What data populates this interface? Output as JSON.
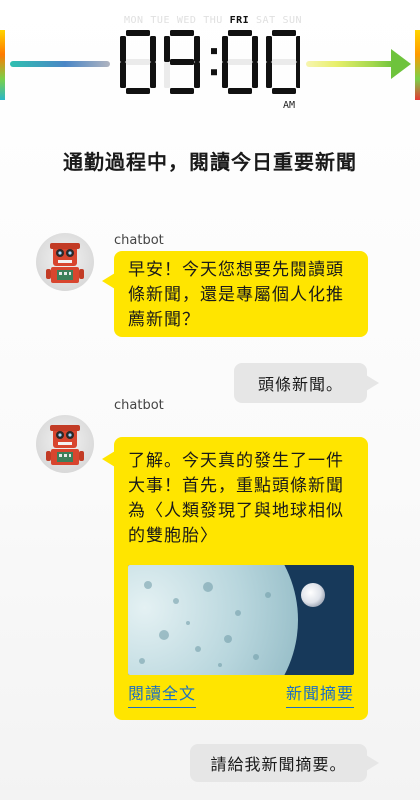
{
  "clock": {
    "days": [
      "MON",
      "TUE",
      "WED",
      "THU",
      "FRI",
      "SAT",
      "SUN"
    ],
    "active_day": "FRI",
    "time": "09:00",
    "ampm": "AM"
  },
  "headline": "通勤過程中，閱讀今日重要新聞",
  "chat": [
    {
      "sender": "chatbot",
      "text": "早安！今天您想要先閱讀頭條新聞，還是專屬個人化推薦新聞？"
    },
    {
      "from": "user",
      "text": "頭條新聞。"
    },
    {
      "sender": "chatbot",
      "text": "了解。今天真的發生了一件大事！首先，重點頭條新聞為〈人類發現了與地球相似的雙胞胎〉",
      "image": "planet-illustration",
      "links": {
        "read_full": "閱讀全文",
        "summary": "新聞摘要"
      }
    },
    {
      "from": "user",
      "text": "請給我新聞摘要。"
    }
  ],
  "colors": {
    "bot_bubble": "#ffe500",
    "user_bubble": "#e6e6e6",
    "link": "#1d6fc1",
    "arrow_green": "#6ec33c",
    "avatar_red": "#d8452e"
  }
}
